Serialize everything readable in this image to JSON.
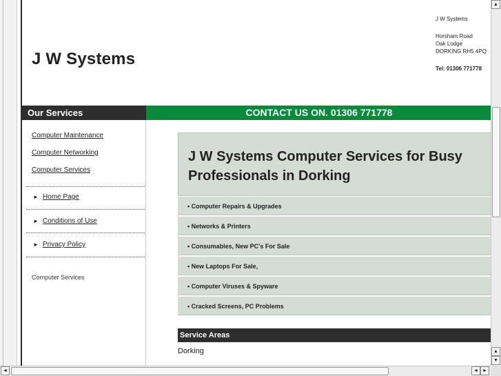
{
  "site": {
    "logo": "J W Systems"
  },
  "address": {
    "company": "J W Systems",
    "line1": "Horsham Road",
    "line2": "Oak Lodge",
    "line3": "DORKING RH5 4PQ",
    "tel": "Tel: 01306 771778"
  },
  "sidebar": {
    "header": "Our Services",
    "service_links": [
      "Computer Maintenance",
      "Computer Networking",
      "Computer Services"
    ],
    "nav": [
      "Home Page",
      "Conditions of Use",
      "Privacy Policy"
    ],
    "note": "Computer Services"
  },
  "contact_bar": "CONTACT US ON. 01306 771778",
  "main": {
    "hero_title": "J W Systems Computer Services for Busy Professionals in Dorking",
    "list": [
      "• Computer Repairs & Upgrades",
      "• Networks & Printers",
      "• Consumables, New PC's For Sale",
      "• New Laptops For Sale,",
      "• Computer Viruses & Spyware",
      "• Cracked Screens, PC Problems"
    ],
    "areas_header": "Service Areas",
    "areas_text": "Dorking"
  },
  "icons": {
    "scroll_up": "arrow-up-icon",
    "scroll_down": "arrow-down-icon",
    "scroll_left": "arrow-left-icon",
    "scroll_right": "arrow-right-icon",
    "nav_bullet": "triangle-right-icon"
  },
  "colors": {
    "contact_bar": "#0a8a3c",
    "dark_header": "#2e2e2e",
    "panel": "#d4dcd5"
  }
}
